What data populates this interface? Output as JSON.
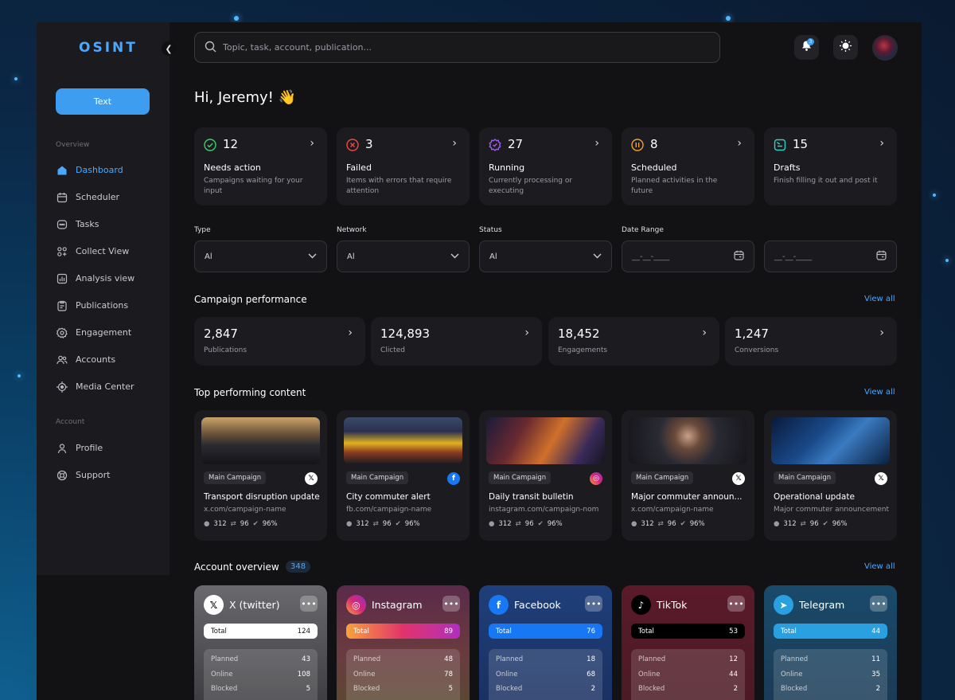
{
  "sidebar": {
    "logo": "OSINT",
    "collapse_icon": "chevron-left",
    "primary_button": "Text",
    "overview_heading": "Overview",
    "account_heading": "Account",
    "items": [
      {
        "label": "Dashboard",
        "icon": "home-icon"
      },
      {
        "label": "Scheduler",
        "icon": "calendar-icon"
      },
      {
        "label": "Tasks",
        "icon": "chat-bubble-icon"
      },
      {
        "label": "Collect View",
        "icon": "grid-plus-icon"
      },
      {
        "label": "Analysis view",
        "icon": "bar-chart-icon"
      },
      {
        "label": "Publications",
        "icon": "clipboard-icon"
      },
      {
        "label": "Engagement",
        "icon": "gear-icon"
      },
      {
        "label": "Accounts",
        "icon": "users-icon"
      },
      {
        "label": "Media Center",
        "icon": "target-icon"
      }
    ],
    "account_items": [
      {
        "label": "Profile",
        "icon": "user-icon"
      },
      {
        "label": "Support",
        "icon": "support-icon"
      }
    ]
  },
  "topbar": {
    "search_placeholder": "Topic, task, account, publication...",
    "notification_count": "3"
  },
  "greeting": "Hi, Jeremy! 👋",
  "stats": [
    {
      "value": "12",
      "title": "Needs action",
      "desc": "Campaigns waiting for your input",
      "color": "#3ecf6e",
      "icon": "check-circle-icon"
    },
    {
      "value": "3",
      "title": "Failed",
      "desc": "Items with errors that require attention",
      "color": "#f04848",
      "icon": "x-circle-icon"
    },
    {
      "value": "27",
      "title": "Running",
      "desc": "Currently processing or executing",
      "color": "#a35cf0",
      "icon": "gear-badge-icon"
    },
    {
      "value": "8",
      "title": "Scheduled",
      "desc": "Planned activities in the future",
      "color": "#f0a030",
      "icon": "pause-circle-icon"
    },
    {
      "value": "15",
      "title": "Drafts",
      "desc": "Finish filling it out and post it",
      "color": "#30d0c0",
      "icon": "draft-icon"
    }
  ],
  "filters": {
    "type_label": "Type",
    "type_value": "Al",
    "network_label": "Network",
    "network_value": "Al",
    "status_label": "Status",
    "status_value": "Al",
    "date_label": "Date Range",
    "date_start": "__-__-____",
    "date_end": "__-__-____"
  },
  "performance": {
    "title": "Campaign performance",
    "view_all": "View all",
    "items": [
      {
        "value": "2,847",
        "label": "Publications"
      },
      {
        "value": "124,893",
        "label": "Clicted"
      },
      {
        "value": "18,452",
        "label": "Engagements"
      },
      {
        "value": "1,247",
        "label": "Conversions"
      }
    ]
  },
  "top_content": {
    "title": "Top performing content",
    "view_all": "View all",
    "items": [
      {
        "tag": "Main Campaign",
        "network": "x",
        "title": "Transport disruption update",
        "url": "x.com/campaign-name",
        "comments": "312",
        "reposts": "96",
        "rate": "96%"
      },
      {
        "tag": "Main Campaign",
        "network": "facebook",
        "title": "City commuter alert",
        "url": "fb.com/campaign-name",
        "comments": "312",
        "reposts": "96",
        "rate": "96%"
      },
      {
        "tag": "Main Campaign",
        "network": "instagram",
        "title": "Daily transit bulletin",
        "url": "instagram.com/campaign-nom",
        "comments": "312",
        "reposts": "96",
        "rate": "96%"
      },
      {
        "tag": "Main Campaign",
        "network": "x",
        "title": "Major commuter announ...",
        "url": "x.com/campaign-name",
        "comments": "312",
        "reposts": "96",
        "rate": "96%"
      },
      {
        "tag": "Main Campaign",
        "network": "x",
        "title": "Operational update",
        "url": "Major commuter announcement",
        "comments": "312",
        "reposts": "96",
        "rate": "96%"
      }
    ]
  },
  "accounts": {
    "title": "Account overview",
    "count": "348",
    "view_all": "View all",
    "items": [
      {
        "name": "X (twitter)",
        "total_label": "Total",
        "total": "124",
        "planned": "43",
        "online": "108",
        "blocked": "5"
      },
      {
        "name": "Instagram",
        "total_label": "Total",
        "total": "89",
        "planned": "48",
        "online": "78",
        "blocked": "5"
      },
      {
        "name": "Facebook",
        "total_label": "Total",
        "total": "76",
        "planned": "18",
        "online": "68",
        "blocked": "2"
      },
      {
        "name": "TikTok",
        "total_label": "Total",
        "total": "53",
        "planned": "12",
        "online": "44",
        "blocked": "2"
      },
      {
        "name": "Telegram",
        "total_label": "Total",
        "total": "44",
        "planned": "11",
        "online": "35",
        "blocked": "2"
      }
    ],
    "row_labels": {
      "planned": "Planned",
      "online": "Online",
      "blocked": "Blocked"
    }
  },
  "colors": {
    "accent": "#3d9df0",
    "background": "#121214",
    "card": "#1c1c20"
  }
}
